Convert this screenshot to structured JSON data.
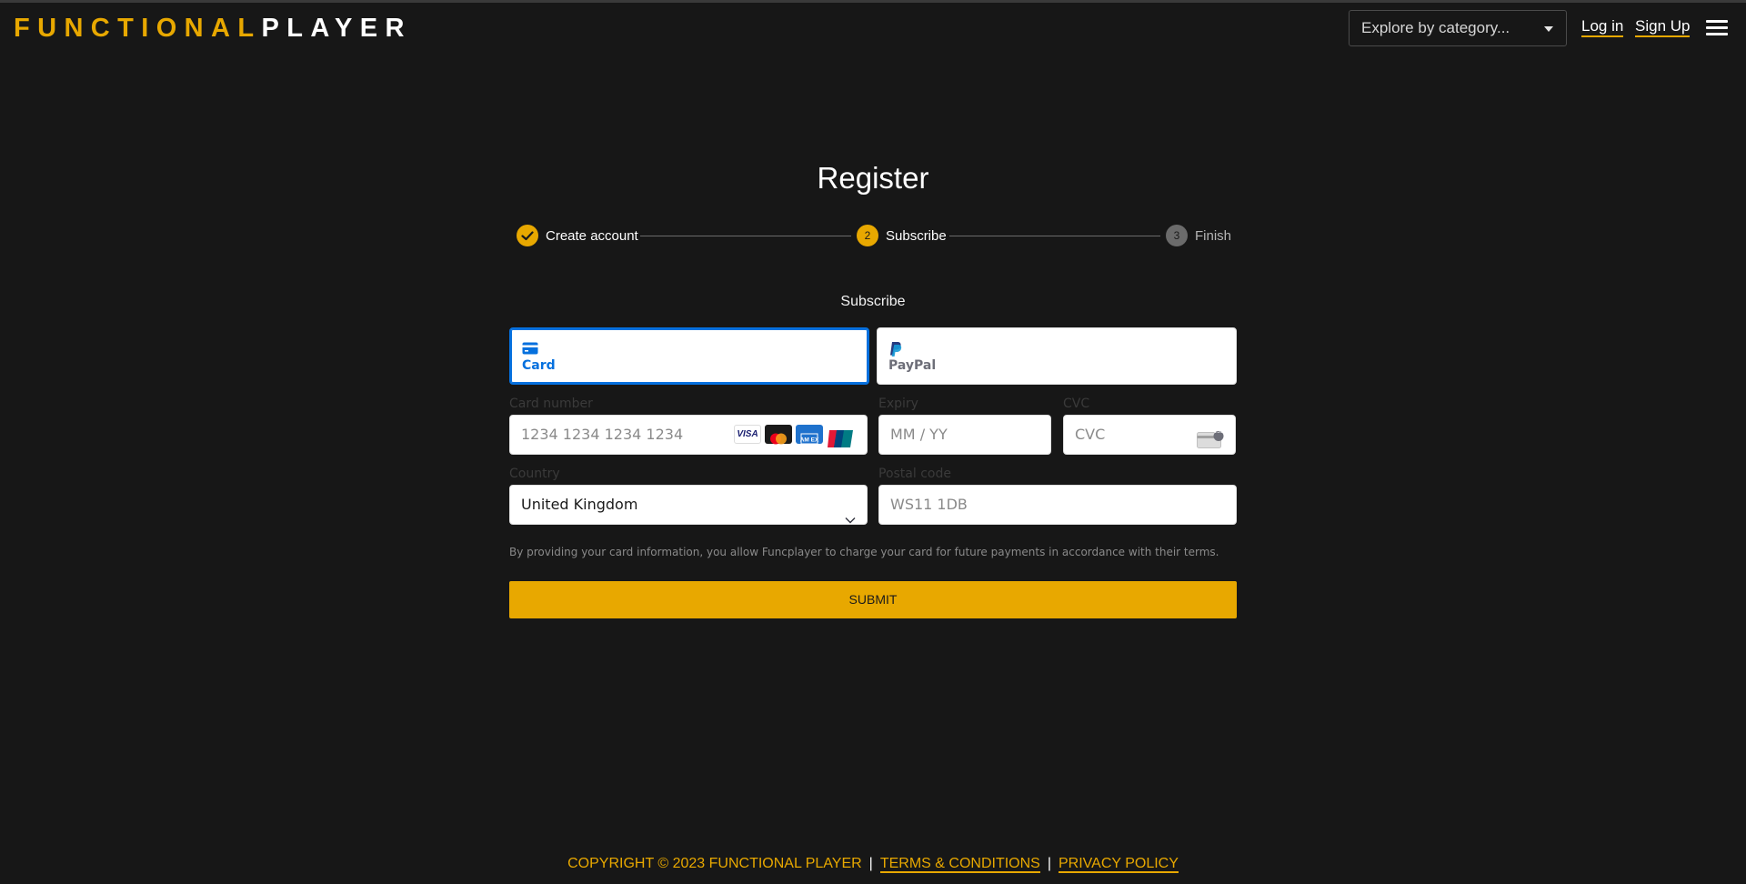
{
  "header": {
    "logo_part1": "FUNCTIONAL",
    "logo_part2": "PLAYER",
    "explore_placeholder": "Explore by category...",
    "login_label": "Log in",
    "signup_label": "Sign Up"
  },
  "register": {
    "title": "Register",
    "steps": [
      {
        "label": "Create account",
        "number": "",
        "state": "done"
      },
      {
        "label": "Subscribe",
        "number": "2",
        "state": "active"
      },
      {
        "label": "Finish",
        "number": "3",
        "state": "pending"
      }
    ],
    "subheading": "Subscribe"
  },
  "payment": {
    "tabs": [
      {
        "label": "Card",
        "icon": "credit-card-icon",
        "selected": true
      },
      {
        "label": "PayPal",
        "icon": "paypal-icon",
        "selected": false
      }
    ],
    "card_number": {
      "label": "Card number",
      "placeholder": "1234 1234 1234 1234",
      "brands": [
        "VISA",
        "mastercard",
        "AMEX",
        "UnionPay"
      ]
    },
    "expiry": {
      "label": "Expiry",
      "placeholder": "MM / YY"
    },
    "cvc": {
      "label": "CVC",
      "placeholder": "CVC",
      "badge": "135"
    },
    "country": {
      "label": "Country",
      "value": "United Kingdom"
    },
    "postal": {
      "label": "Postal code",
      "placeholder": "WS11 1DB"
    },
    "note": "By providing your card information, you allow Funcplayer to charge your card for future payments in accordance with their terms.",
    "submit_label": "SUBMIT"
  },
  "footer": {
    "copyright": "COPYRIGHT © 2023 FUNCTIONAL PLAYER",
    "separator": "|",
    "terms_label": "TERMS & CONDITIONS",
    "privacy_label": "PRIVACY POLICY"
  },
  "colors": {
    "accent": "#e8a800",
    "background": "#171717",
    "stripe_blue": "#0570de"
  }
}
